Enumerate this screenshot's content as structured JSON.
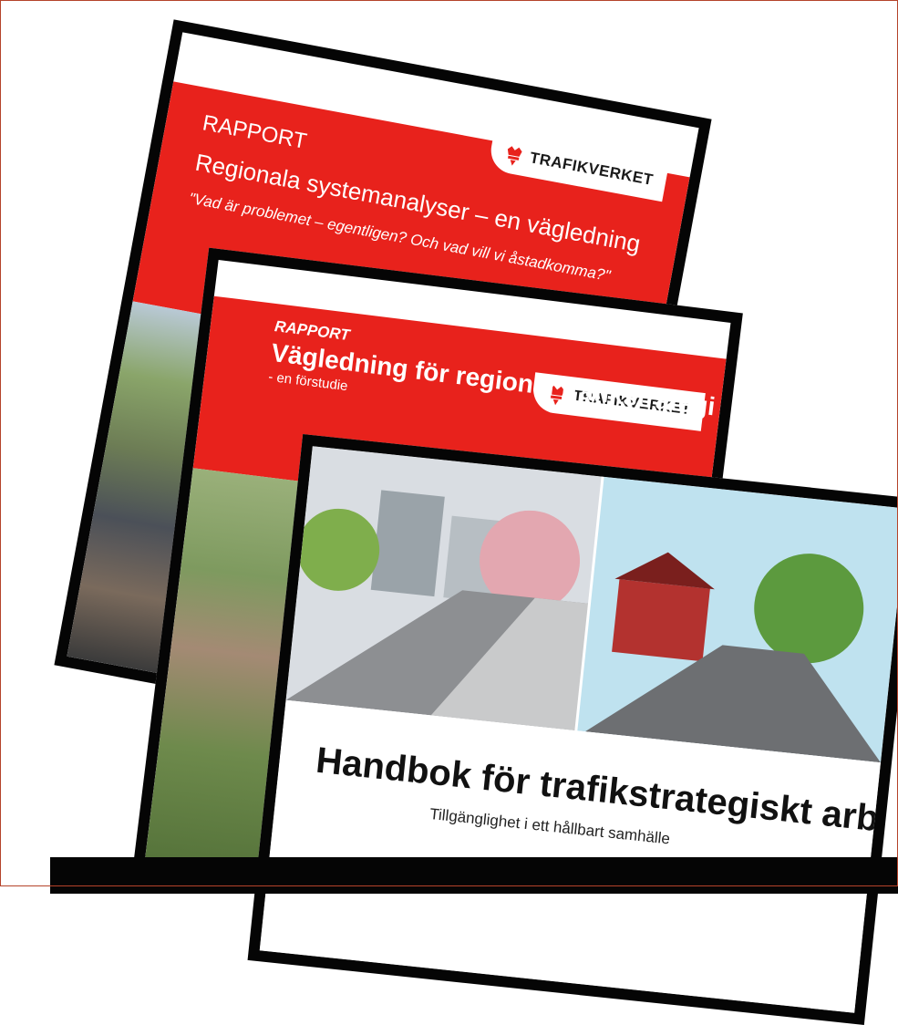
{
  "doc1": {
    "rapport": "RAPPORT",
    "title": "Regionala systemanalyser – en vägledning",
    "subtitle": "\"Vad är problemet – egentligen? Och vad vill vi åstadkomma?\"",
    "logo": "TRAFIKVERKET"
  },
  "doc2": {
    "rapport": "RAPPORT",
    "title": "Vägledning för regional trafikstrategi",
    "subtitle": "- en förstudie",
    "logo": "TRAFIKVERKET"
  },
  "doc3": {
    "title": "Handbok för trafikstrategiskt arbete",
    "subtitle": "Tillgänglighet i ett hållbart samhälle"
  },
  "colors": {
    "brand_red": "#e8221c",
    "border": "#050505"
  },
  "icons": [
    "crown-icon"
  ]
}
